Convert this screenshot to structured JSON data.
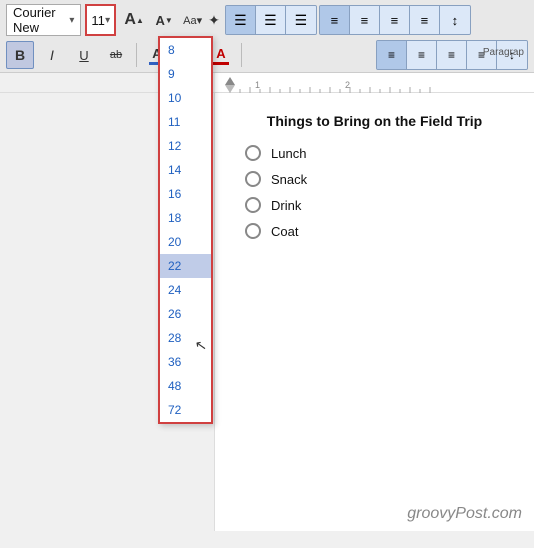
{
  "toolbar": {
    "font_name": "Courier New",
    "font_size": "11",
    "bold_label": "B",
    "italic_label": "I",
    "underline_label": "U",
    "strikethrough_label": "ab",
    "grow_icon": "A",
    "shrink_icon": "A",
    "case_label": "Aa▾",
    "clear_format": "✦",
    "color_text": "A",
    "highlight": "A",
    "paragraph_group_label": "Paragrap"
  },
  "font_dropdown": {
    "items": [
      "8",
      "9",
      "10",
      "11",
      "12",
      "14",
      "16",
      "18",
      "20",
      "22",
      "24",
      "26",
      "28",
      "36",
      "48",
      "72"
    ],
    "highlighted": "22"
  },
  "ribbon_right": {
    "list_buttons": [
      "≡",
      "≡",
      "≡"
    ],
    "align_buttons": [
      "≡",
      "≡",
      "≡",
      "≡",
      "↕"
    ]
  },
  "document": {
    "title": "Things to Bring on the Field Trip",
    "items": [
      "Lunch",
      "Snack",
      "Drink",
      "Coat"
    ]
  },
  "watermark": "groovyPost.com",
  "ruler": {
    "markers": [
      "1",
      "2"
    ]
  }
}
